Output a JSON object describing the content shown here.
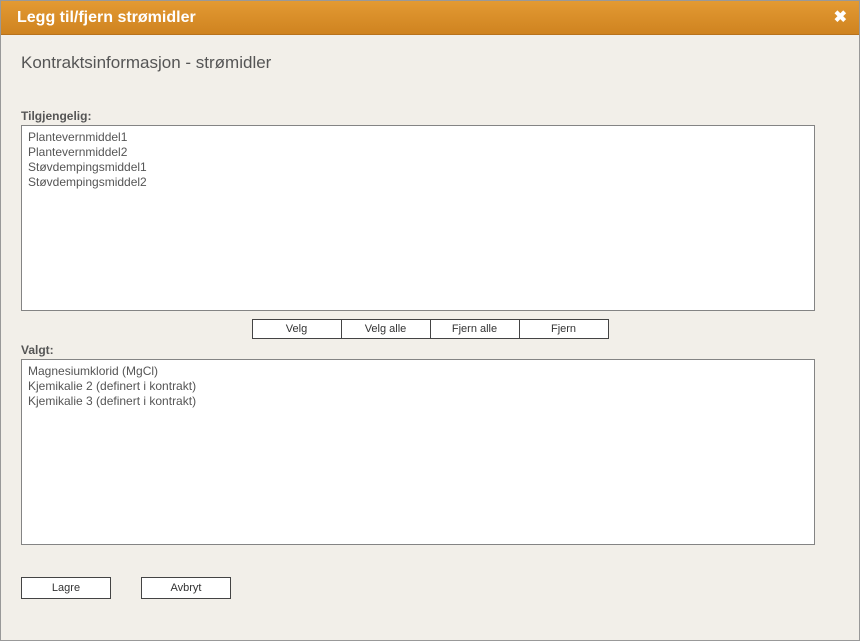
{
  "titlebar": {
    "title": "Legg til/fjern strømidler"
  },
  "subheading": "Kontraktsinformasjon - strømidler",
  "labels": {
    "available": "Tilgjengelig:",
    "selected": "Valgt:"
  },
  "available_items": [
    "Plantevernmiddel1",
    "Plantevernmiddel2",
    "Støvdempingsmiddel1",
    "Støvdempingsmiddel2"
  ],
  "selected_items": [
    "Magnesiumklorid (MgCl)",
    "Kjemikalie 2 (definert i kontrakt)",
    "Kjemikalie 3 (definert i kontrakt)"
  ],
  "buttons": {
    "select": "Velg",
    "select_all": "Velg alle",
    "remove_all": "Fjern alle",
    "remove": "Fjern",
    "save": "Lagre",
    "cancel": "Avbryt"
  }
}
